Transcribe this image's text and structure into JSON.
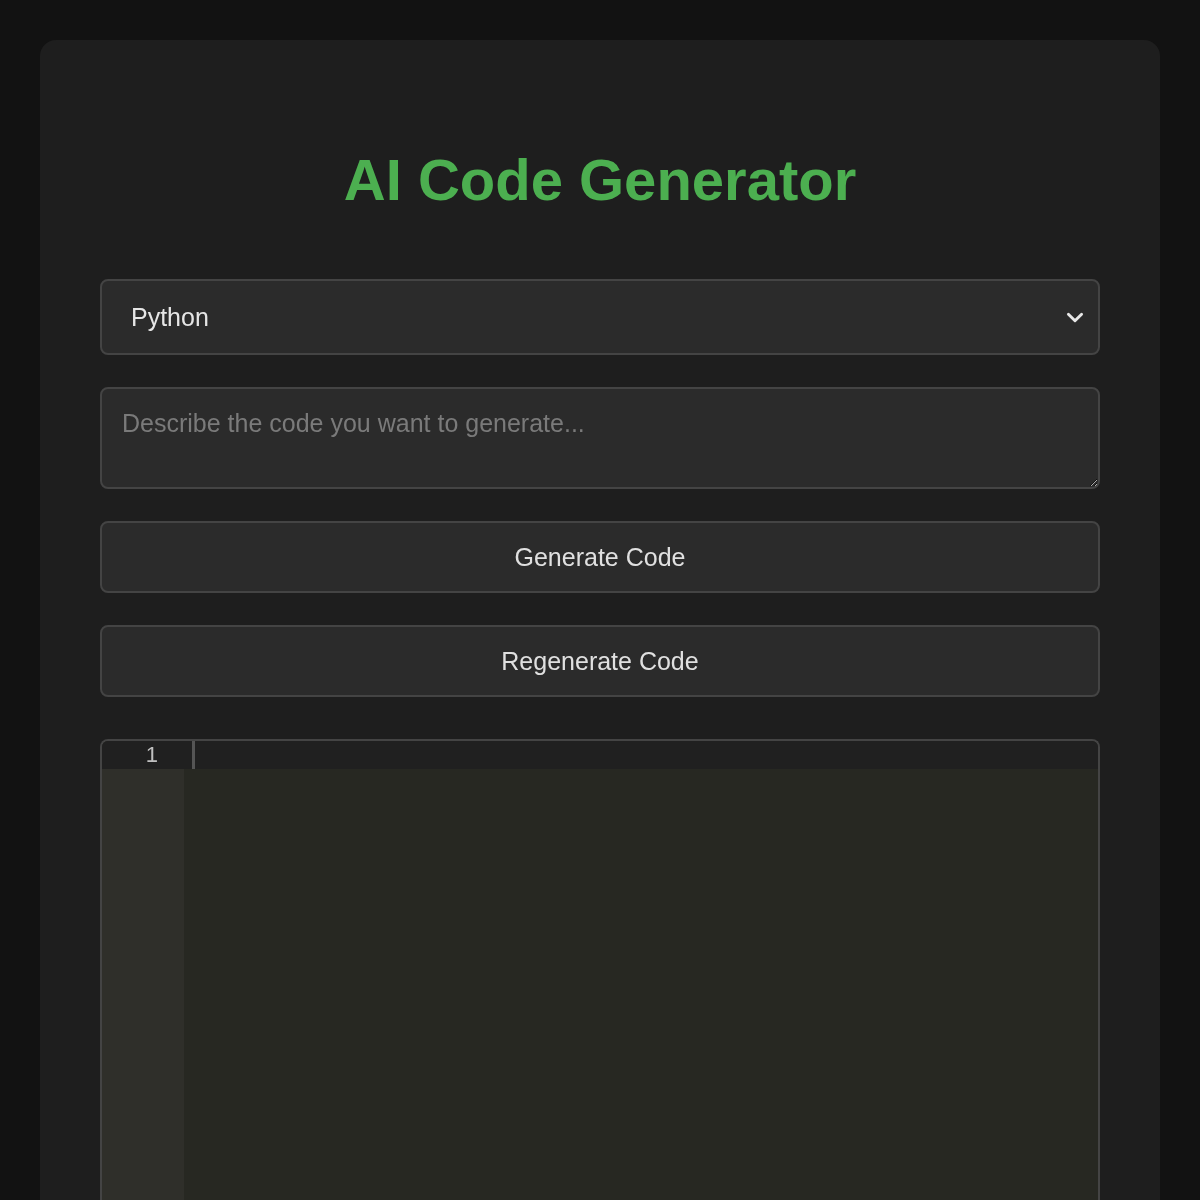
{
  "title": "AI Code Generator",
  "language_select": {
    "value": "Python"
  },
  "prompt": {
    "placeholder": "Describe the code you want to generate..."
  },
  "buttons": [
    "Generate Code",
    "Regenerate Code"
  ],
  "editor": {
    "lines": [
      {
        "number": "1",
        "active": true
      }
    ]
  }
}
